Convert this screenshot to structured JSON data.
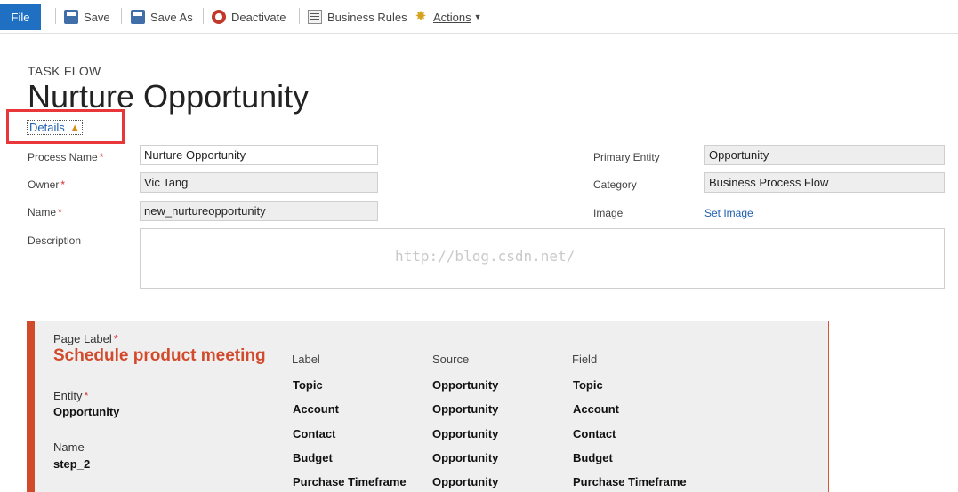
{
  "toolbar": {
    "file": "File",
    "save": "Save",
    "save_as": "Save As",
    "deactivate": "Deactivate",
    "business_rules": "Business Rules",
    "actions": "Actions"
  },
  "header": {
    "entity_type": "TASK FLOW",
    "title": "Nurture Opportunity",
    "details_link": "Details"
  },
  "form": {
    "process_name_label": "Process Name",
    "process_name_value": "Nurture Opportunity",
    "owner_label": "Owner",
    "owner_value": "Vic Tang",
    "name_label": "Name",
    "name_value": "new_nurtureopportunity",
    "description_label": "Description",
    "primary_entity_label": "Primary Entity",
    "primary_entity_value": "Opportunity",
    "category_label": "Category",
    "category_value": "Business Process Flow",
    "image_label": "Image",
    "set_image": "Set Image",
    "required_marker": "*"
  },
  "watermark": "http://blog.csdn.net/",
  "stage": {
    "page_label_label": "Page Label",
    "page_label_value": "Schedule product meeting",
    "entity_label": "Entity",
    "entity_value": "Opportunity",
    "name_label": "Name",
    "name_value": "step_2",
    "columns": [
      "Label",
      "Source",
      "Field"
    ],
    "rows": [
      [
        "Topic",
        "Opportunity",
        "Topic"
      ],
      [
        "Account",
        "Opportunity",
        "Account"
      ],
      [
        "Contact",
        "Opportunity",
        "Contact"
      ],
      [
        "Budget",
        "Opportunity",
        "Budget"
      ],
      [
        "Purchase Timeframe",
        "Opportunity",
        "Purchase Timeframe"
      ]
    ]
  },
  "colors": {
    "file_button": "#1f6fc2",
    "stage_accent": "#d24a2c",
    "highlight_box": "#e8363a",
    "link": "#1f5fae"
  }
}
